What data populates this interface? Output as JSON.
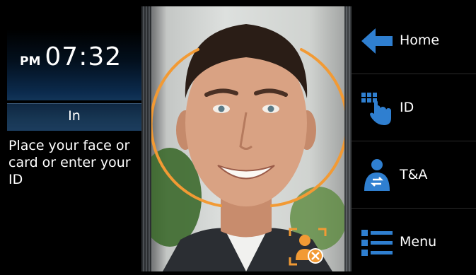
{
  "clock": {
    "ampm": "PM",
    "time": "07:32"
  },
  "status": {
    "mode": "In"
  },
  "prompt": "Place your face or card or enter your ID",
  "menu": [
    {
      "label": "Home",
      "icon": "arrow-left-icon"
    },
    {
      "label": "ID",
      "icon": "keypad-hand-icon"
    },
    {
      "label": "T&A",
      "icon": "user-switch-icon"
    },
    {
      "label": "Menu",
      "icon": "list-menu-icon"
    }
  ],
  "colors": {
    "accent_orange": "#f29a34",
    "icon_blue": "#2f7fd0",
    "status_bar": "#173653"
  }
}
